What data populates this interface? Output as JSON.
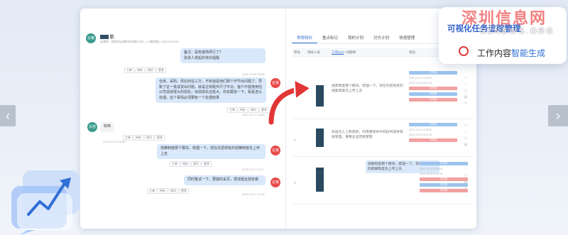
{
  "nav": {
    "prev": "‹",
    "next": "›"
  },
  "watermark": {
    "title": "深圳信息网",
    "sub": "SZNEWS.ORG"
  },
  "callout": {
    "top": "可视化任务追踪管理",
    "main_pre": "工作内容",
    "main_hl": "智能生成"
  },
  "chat": {
    "header": {
      "avatar": "云猪",
      "name_suffix": "鹏",
      "sub": "云猪家（深圳市云猪科技有限公司）| 人事经理 | 13823716295"
    },
    "msgs": [
      {
        "text": "备注：是有装饰供行了？",
        "text2": "张进人发起的待办提醒",
        "time": "2022-10-26 20:58"
      },
      {
        "text": "仓库、采购、供应商这三方，不知道是他们那个环节出问题了，导致了这一批成货出问题，就是过桥配件尺寸不对。客户不能使用估公司造成很大的损失；目前损失还挺大。你去跟进一下，看看怎么处理。这个事情必须要有一个处理结果",
        "time": "2022-10-27 18:45",
        "avatar": "云良"
      },
      {
        "text": "收到",
        "time": "2022-10-27 18:46",
        "avatar": "云倍"
      },
      {
        "text": "观察制度那个模块，梳理一下，现在先把现有的观察制度先上传上去",
        "time": "2022-10-27 19:17",
        "avatar": "云良"
      },
      {
        "text": "同时整试一下，要建的采页，把流程全部走做",
        "time": "2022-10-27 19:18",
        "avatar": "云良"
      }
    ],
    "actions": [
      "工单",
      "待办",
      "知识",
      "更多"
    ]
  },
  "tasks": {
    "tabs": [
      "常规待办",
      "重点标记",
      "我的计划",
      "对方计划",
      "快速管理"
    ],
    "active_tab": 0,
    "headers": {
      "num": "序号",
      "owner": "待办人员",
      "desc_focus": "工作(12)",
      "desc": " / 问题单",
      "status": "状态"
    },
    "rows": [
      {
        "num": "1",
        "desc": "搜索制度整个模块，梳理一下，现在先把现有的搜集制度先上传上去",
        "status": [
          "已完成",
          "2022-10-21 10:05:00",
          "2022-10-25 10:01:23",
          "未完成"
        ]
      },
      {
        "num": "2",
        "desc": "知道合人上照观到，利用重新并中前段供成供有收管理，重整业运营看整理",
        "status": [
          "已完成",
          "2022-10-21 10:05:00",
          "2022-10-25 10:01:23",
          "未完成"
        ]
      },
      {
        "num": "3",
        "desc": "观察制度那个模块，梳理一下，现在先把现有的观察制度先上传上去",
        "status": [
          "已完成",
          "2022-10-21 10:05:00",
          "2022-10-25 10:01:23",
          "未完成"
        ]
      }
    ]
  },
  "colors": {
    "accent": "#2f6fd6",
    "bubble": "#d9e8fb",
    "arrow": "#e23535",
    "brand_red": "#f06a6a"
  }
}
